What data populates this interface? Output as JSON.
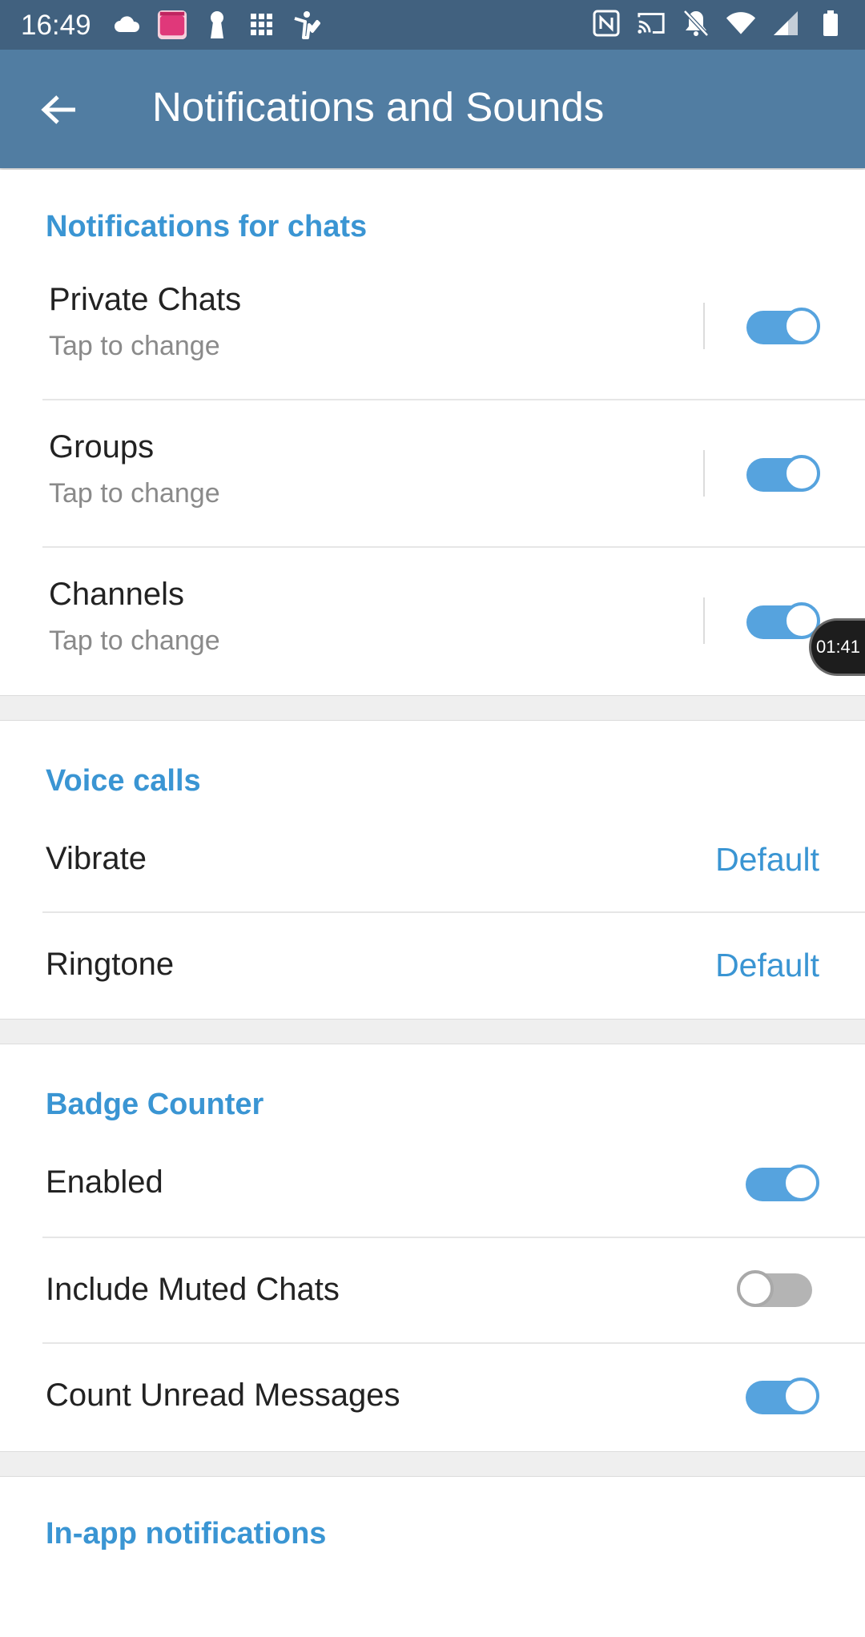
{
  "status_bar": {
    "time": "16:49",
    "left_icons": [
      "cloud-icon",
      "app-notification-icon",
      "keyhole-icon",
      "grid-icon",
      "figure-icon"
    ],
    "right_icons": [
      "nfc-icon",
      "cast-icon",
      "bell-off-icon",
      "wifi-icon",
      "signal-icon",
      "battery-icon"
    ]
  },
  "app_bar": {
    "back_icon": "arrow-left-icon",
    "title": "Notifications and Sounds"
  },
  "chats_section": {
    "header": "Notifications for chats",
    "items": [
      {
        "title": "Private Chats",
        "subtitle": "Tap to change",
        "enabled": true
      },
      {
        "title": "Groups",
        "subtitle": "Tap to change",
        "enabled": true
      },
      {
        "title": "Channels",
        "subtitle": "Tap to change",
        "enabled": true
      }
    ]
  },
  "voice_section": {
    "header": "Voice calls",
    "items": [
      {
        "title": "Vibrate",
        "value": "Default"
      },
      {
        "title": "Ringtone",
        "value": "Default"
      }
    ]
  },
  "badge_section": {
    "header": "Badge Counter",
    "items": [
      {
        "title": "Enabled",
        "enabled": true
      },
      {
        "title": "Include Muted Chats",
        "enabled": false
      },
      {
        "title": "Count Unread Messages",
        "enabled": true
      }
    ]
  },
  "inapp_section": {
    "header": "In-app notifications"
  },
  "timer_overlay": "01:41",
  "colors": {
    "status_bar": "#41617f",
    "app_bar": "#517da2",
    "accent": "#3a95d3",
    "toggle_on": "#56a3de",
    "toggle_off": "#b4b4b4"
  }
}
